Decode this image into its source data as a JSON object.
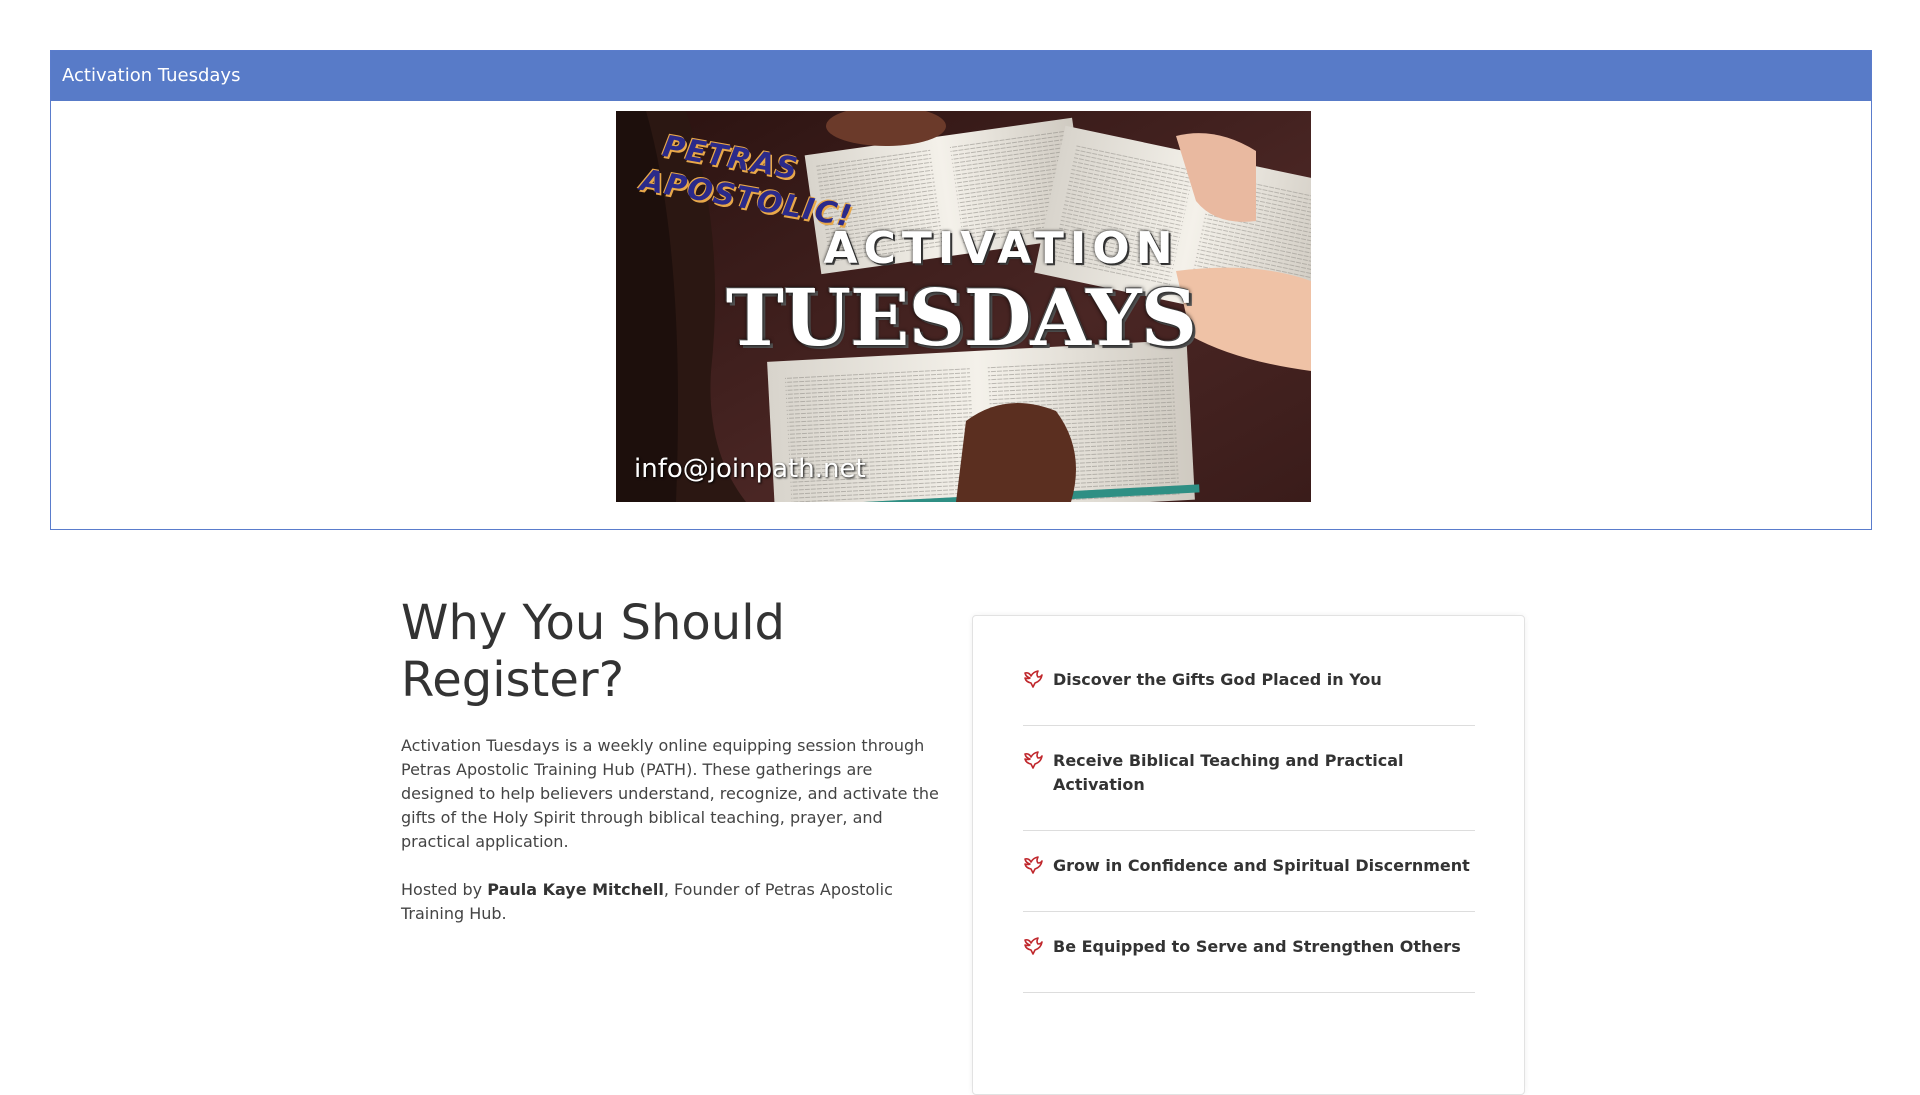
{
  "panel": {
    "title": "Activation Tuesdays",
    "header_color": "#587bc8"
  },
  "banner": {
    "brand_line1": "PETRAS",
    "brand_line2": "APOSTOLIC!",
    "headline_small": "ACTIVATION",
    "headline_big": "TUESDAYS",
    "email": "info@joinpath.net"
  },
  "section": {
    "title": "Why You Should Register?",
    "description": "Activation Tuesdays is a weekly online equipping session through Petras Apostolic Training Hub (PATH). These gatherings are designed to help believers understand, recognize, and activate the gifts of the Holy Spirit through biblical teaching, prayer, and practical application.",
    "host_prefix": "Hosted by ",
    "host_name": "Paula Kaye Mitchell",
    "host_suffix": ", Founder of Petras Apostolic Training Hub."
  },
  "benefits": {
    "icon": "dove-icon",
    "icon_color": "#c0282d",
    "items": [
      {
        "label": "Discover the Gifts God Placed in You"
      },
      {
        "label": "Receive Biblical Teaching and Practical Activation"
      },
      {
        "label": "Grow in Confidence and Spiritual Discernment"
      },
      {
        "label": "Be Equipped to Serve and Strengthen Others"
      }
    ]
  }
}
